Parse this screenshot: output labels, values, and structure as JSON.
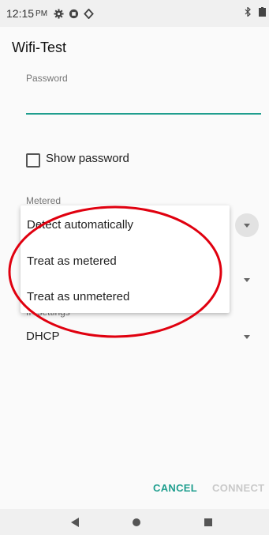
{
  "status_bar": {
    "time": "12:15",
    "ampm": "PM"
  },
  "dialog": {
    "title": "Wifi-Test",
    "password_label": "Password",
    "password_value": "",
    "show_password_label": "Show password",
    "metered_label": "Metered",
    "ip_settings_label": "IP settings",
    "ip_settings_value": "DHCP",
    "cancel_label": "CANCEL",
    "connect_label": "CONNECT"
  },
  "metered_menu": {
    "options": [
      "Detect automatically",
      "Treat as metered",
      "Treat as unmetered"
    ]
  },
  "colors": {
    "accent": "#1f9e8e",
    "annotation": "#e0000f",
    "disabled": "#c9c9c9"
  }
}
